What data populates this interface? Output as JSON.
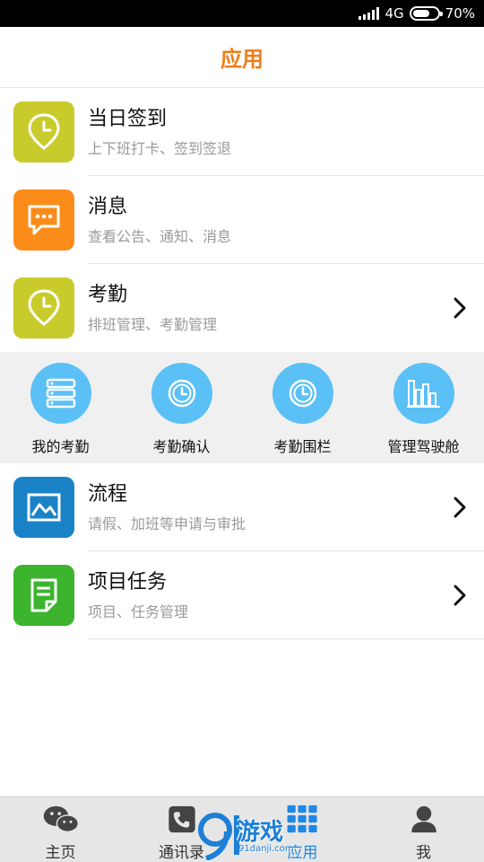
{
  "status_bar": {
    "network": "4G",
    "battery": "70%",
    "battery_level": 0.7
  },
  "header": {
    "title": "应用"
  },
  "rows_top": [
    {
      "title": "当日签到",
      "subtitle": "上下班打卡、签到签退",
      "icon": "clock-pin-icon",
      "color": "#c9cb2c"
    },
    {
      "title": "消息",
      "subtitle": "查看公告、通知、消息",
      "icon": "message-icon",
      "color": "#fb8c1a"
    },
    {
      "title": "考勤",
      "subtitle": "排班管理、考勤管理",
      "icon": "clock-pin-icon",
      "color": "#c9cb2c"
    }
  ],
  "subgrid": [
    {
      "label": "我的考勤",
      "icon": "server-list-icon"
    },
    {
      "label": "考勤确认",
      "icon": "clock-icon"
    },
    {
      "label": "考勤围栏",
      "icon": "clock-icon"
    },
    {
      "label": "管理驾驶舱",
      "icon": "bar-chart-icon"
    }
  ],
  "rows_bottom": [
    {
      "title": "流程",
      "subtitle": "请假、加班等申请与审批",
      "icon": "image-icon",
      "color": "#1a83c8"
    },
    {
      "title": "项目任务",
      "subtitle": "项目、任务管理",
      "icon": "document-edit-icon",
      "color": "#3cb42d"
    }
  ],
  "nav": [
    {
      "label": "主页",
      "icon": "wechat-icon"
    },
    {
      "label": "通讯录",
      "icon": "phone-icon"
    },
    {
      "label": "应用",
      "icon": "grid-icon",
      "active": true
    },
    {
      "label": "我",
      "icon": "person-icon"
    }
  ],
  "watermark": {
    "brand": "游戏",
    "url": "91danji.com"
  },
  "colors": {
    "accent": "#f07d1a",
    "subgrid_circle": "#5bc0f5",
    "nav_active": "#1e88e5"
  }
}
